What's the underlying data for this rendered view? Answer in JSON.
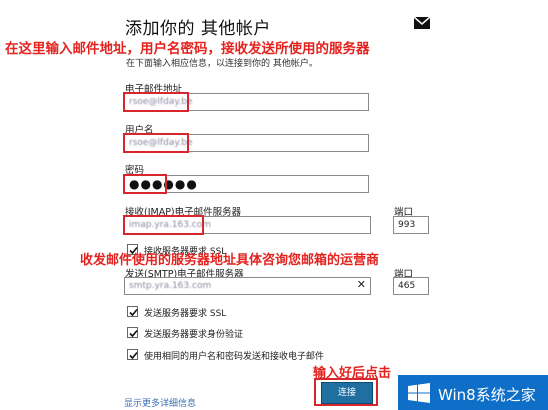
{
  "page_title": "添加你的 其他帐户",
  "subtitle": "在下面输入相应信息，以连接到你的 其他帐户。",
  "annotations": {
    "top": "在这里输入邮件地址，用户名密码，接收发送所使用的服务器",
    "middle": "收发邮件使用的服务器地址具体咨询您邮箱的运营商",
    "bottom": "输入好后点击"
  },
  "fields": {
    "email": {
      "label": "电子邮件地址",
      "value": "rsoe@lfday.be"
    },
    "username": {
      "label": "用户名",
      "value": "rsoe@lfday.be"
    },
    "password": {
      "label": "密码",
      "value": "●●●●●●"
    },
    "imap_server": {
      "label": "接收(IMAP)电子邮件服务器",
      "value": "imap.yra.163.com"
    },
    "imap_port": {
      "label": "端口",
      "value": "993"
    },
    "smtp_server": {
      "label": "发送(SMTP)电子邮件服务器",
      "value": "smtp.yra.163.com"
    },
    "smtp_port": {
      "label": "端口",
      "value": "465"
    }
  },
  "checkboxes": {
    "incoming_ssl": {
      "label": "接收服务器要求 SSL",
      "checked": true
    },
    "outgoing_ssl": {
      "label": "发送服务器要求 SSL",
      "checked": true
    },
    "outgoing_auth": {
      "label": "发送服务器要求身份验证",
      "checked": true
    },
    "same_credentials": {
      "label": "使用相同的用户名和密码发送和接收电子邮件",
      "checked": true
    }
  },
  "link_text": "显示更多详细信息",
  "connect_button": "连接",
  "watermark": "Win8系统之家",
  "icons": {
    "mail": "mail-envelope-icon",
    "clear": "clear-x-icon",
    "check": "checkmark-icon",
    "logo": "windows-logo-icon"
  },
  "colors": {
    "annotation_red": "#e4231f",
    "button_blue": "#1f6fa0",
    "logo_blue": "#0f6fc8"
  }
}
